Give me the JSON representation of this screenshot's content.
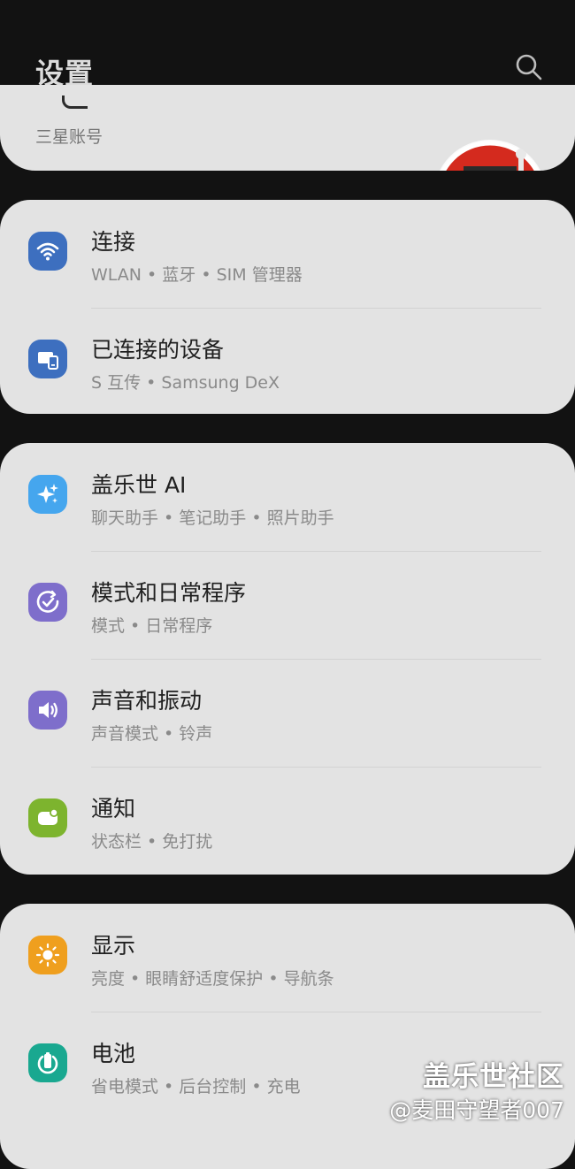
{
  "header": {
    "title": "设置"
  },
  "account": {
    "label": "三星账号"
  },
  "groups": [
    {
      "rows": [
        {
          "title": "连接",
          "sub": "WLAN • 蓝牙 • SIM 管理器",
          "icon": "wifi-icon",
          "color": "#3d6fbf"
        },
        {
          "title": "已连接的设备",
          "sub": "S 互传 • Samsung DeX",
          "icon": "connected-devices-icon",
          "color": "#3d6fbf"
        }
      ]
    },
    {
      "rows": [
        {
          "title": "盖乐世 AI",
          "sub": "聊天助手 • 笔记助手 • 照片助手",
          "icon": "sparkle-icon",
          "color": "#45a6ee"
        },
        {
          "title": "模式和日常程序",
          "sub": "模式 • 日常程序",
          "icon": "modes-routines-icon",
          "color": "#7e6ecb"
        },
        {
          "title": "声音和振动",
          "sub": "声音模式 • 铃声",
          "icon": "speaker-icon",
          "color": "#7e6ecb"
        },
        {
          "title": "通知",
          "sub": "状态栏 • 免打扰",
          "icon": "notification-icon",
          "color": "#7db42e"
        }
      ]
    },
    {
      "rows": [
        {
          "title": "显示",
          "sub": "亮度 • 眼睛舒适度保护 • 导航条",
          "icon": "sun-icon",
          "color": "#ef9f1e"
        },
        {
          "title": "电池",
          "sub": "省电模式 • 后台控制 • 充电",
          "icon": "battery-icon",
          "color": "#19a890"
        }
      ]
    }
  ],
  "watermark": {
    "line1": "盖乐世社区",
    "line2": "@麦田守望者007"
  }
}
